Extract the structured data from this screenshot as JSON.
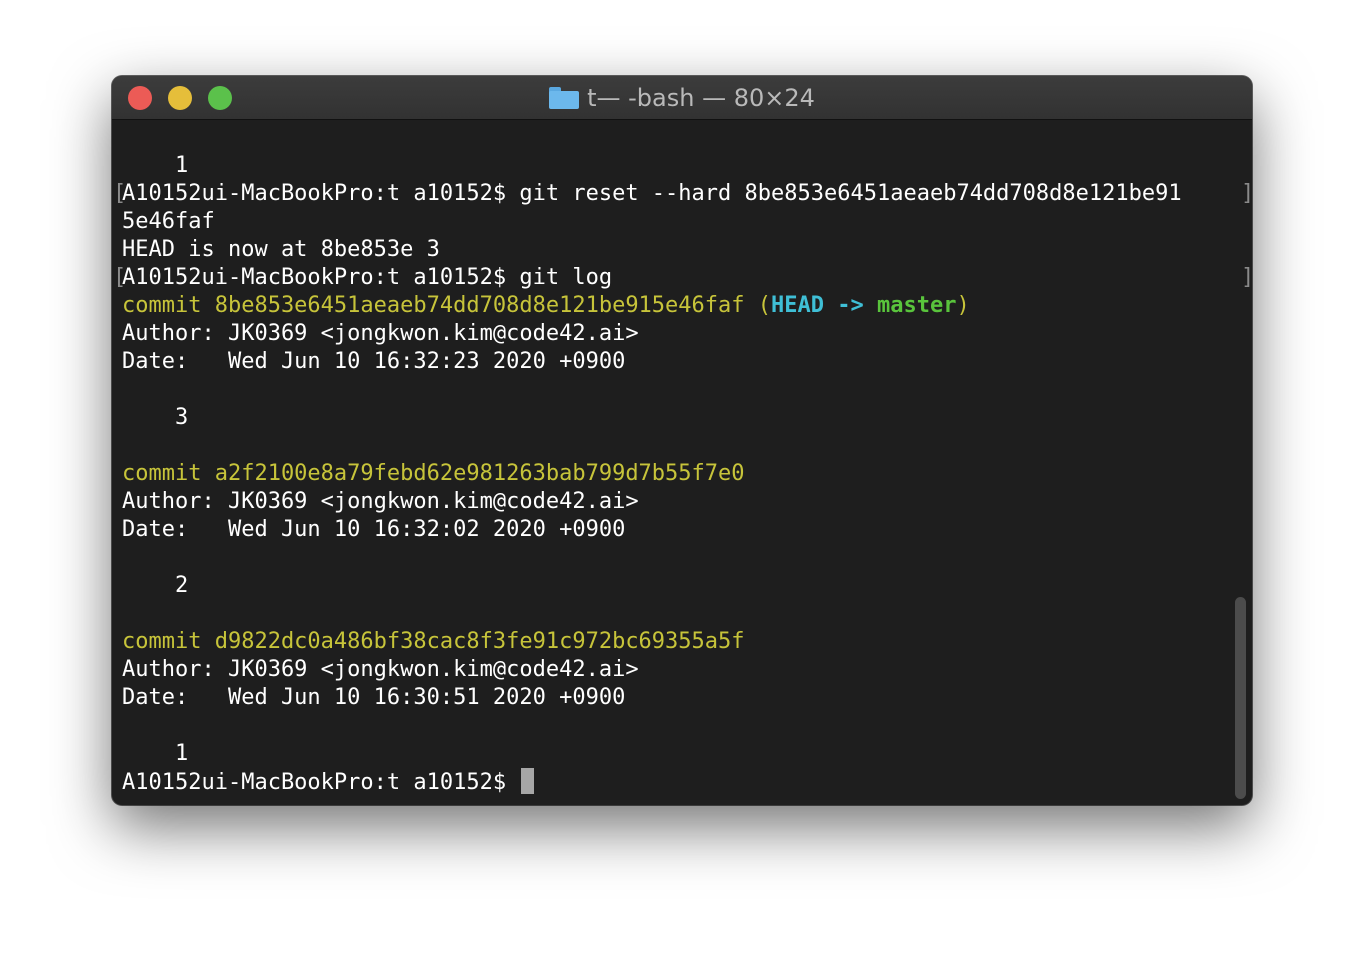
{
  "window": {
    "title_dir": "t",
    "title_rest": " — -bash — 80×24"
  },
  "terminal": {
    "lines": [
      "    1",
      "A10152ui-MacBookPro:t a10152$ git reset --hard 8be853e6451aeaeb74dd708d8e121be91",
      "5e46faf",
      "HEAD is now at 8be853e 3",
      "A10152ui-MacBookPro:t a10152$ git log",
      "",
      "Author: JK0369 <jongkwon.kim@code42.ai>",
      "Date:   Wed Jun 10 16:32:23 2020 +0900",
      "",
      "    3",
      "",
      "commit a2f2100e8a79febd62e981263bab799d7b55f7e0",
      "Author: JK0369 <jongkwon.kim@code42.ai>",
      "Date:   Wed Jun 10 16:32:02 2020 +0900",
      "",
      "    2",
      "",
      "commit d9822dc0a486bf38cac8f3fe91c972bc69355a5f",
      "Author: JK0369 <jongkwon.kim@code42.ai>",
      "Date:   Wed Jun 10 16:30:51 2020 +0900",
      "",
      "    1",
      "A10152ui-MacBookPro:t a10152$ "
    ],
    "head_commit": {
      "prefix": "commit 8be853e6451aeaeb74dd708d8e121be915e46faf (",
      "head": "HEAD -> ",
      "branch": "master",
      "suffix": ")"
    },
    "colors": {
      "commit": "#c7c43a",
      "head": "#3fbfd6",
      "branch": "#59c43c",
      "text": "#ffffff",
      "background": "#1e1e1e"
    }
  }
}
